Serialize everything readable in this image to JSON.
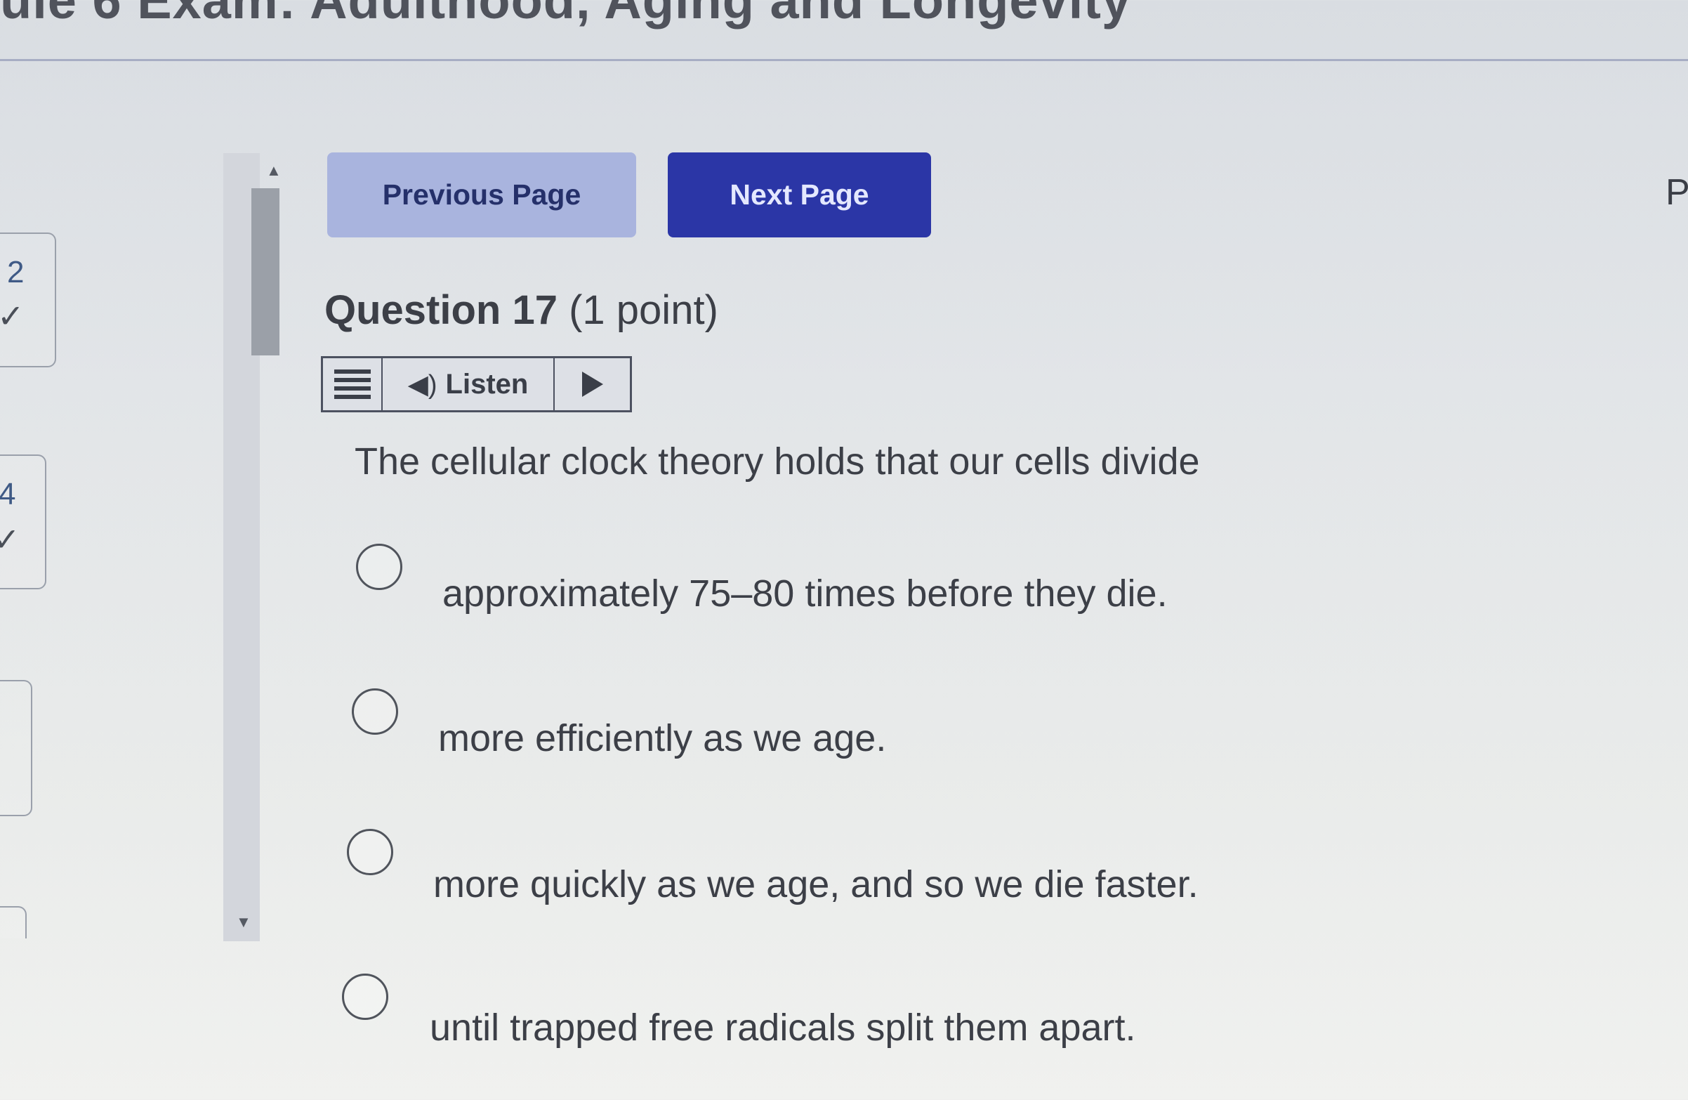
{
  "header": {
    "title": "ule 6 Exam: Adulthood, Aging and Longevity"
  },
  "right_edge": {
    "label": "P"
  },
  "question_status": [
    {
      "number": "2",
      "check": "✓"
    },
    {
      "number": "4",
      "check": "✓"
    },
    {
      "number": "",
      "check": ""
    },
    {
      "number": "",
      "check": ""
    }
  ],
  "navigation": {
    "previous_label": "Previous Page",
    "next_label": "Next Page"
  },
  "question": {
    "title": "Question 17",
    "points": "(1 point)",
    "text": "The cellular clock theory holds that our cells divide",
    "options": [
      {
        "label": "approximately 75–80 times before they die."
      },
      {
        "label": "more efficiently as we age."
      },
      {
        "label": "more quickly as we age, and so we die faster."
      },
      {
        "label": "until trapped free radicals split them apart."
      }
    ]
  },
  "listen_bar": {
    "label": "Listen",
    "icons": [
      "menu-icon",
      "speaker-icon",
      "play-icon"
    ]
  },
  "colors": {
    "next_button": "#2b36a6",
    "previous_button": "#a9b4de",
    "background": "#e2e5e8"
  }
}
